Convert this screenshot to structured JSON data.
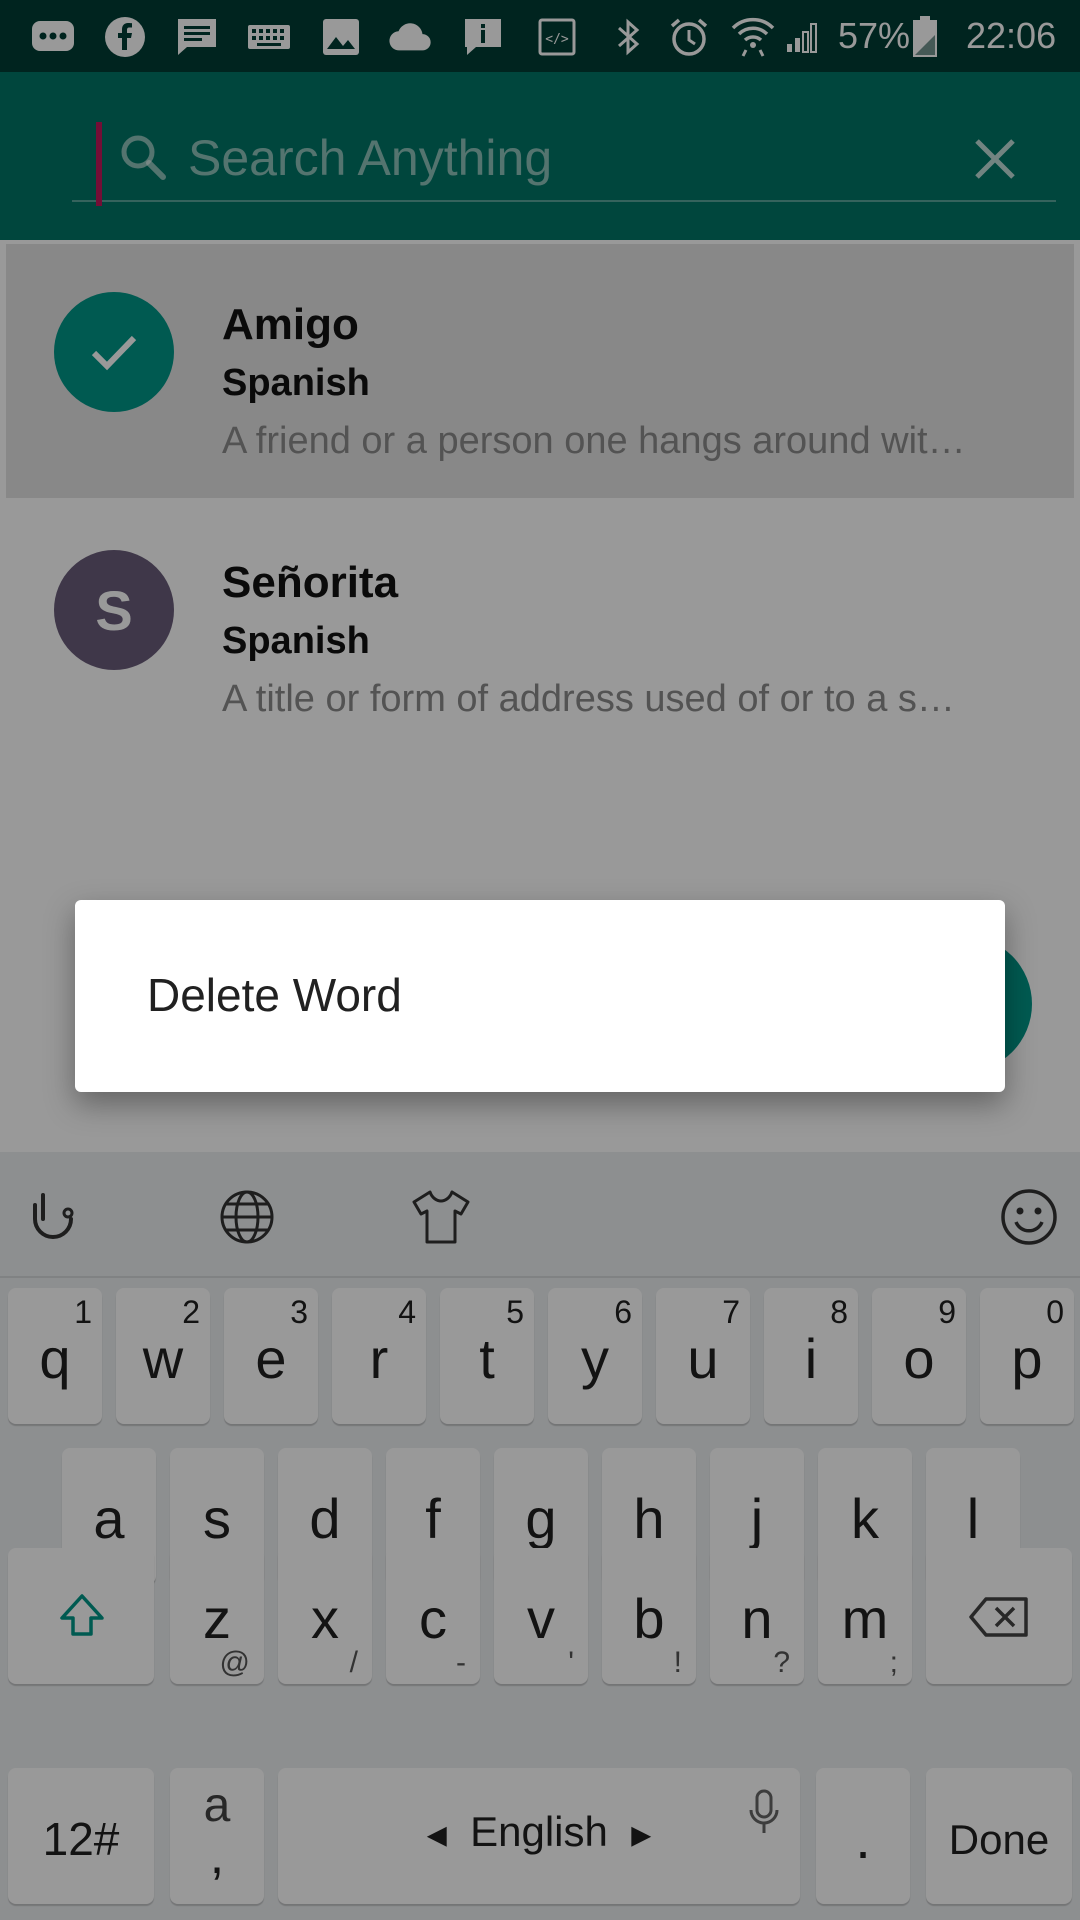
{
  "status_bar": {
    "battery": "57%",
    "time": "22:06",
    "icons": [
      "messages-icon",
      "facebook-icon",
      "chat-icon",
      "keyboard-icon",
      "image-icon",
      "cloud-icon",
      "info-icon",
      "code-icon",
      "bluetooth-icon",
      "alarm-icon",
      "wifi-icon",
      "signal-icon",
      "battery-icon"
    ]
  },
  "search": {
    "placeholder": "Search Anything",
    "value": ""
  },
  "colors": {
    "primary": "#009688",
    "primary_dark": "#00574b",
    "accent": "#c2185b",
    "avatar_s": "#6a5d7a"
  },
  "words": [
    {
      "avatar": "",
      "word": "Amigo",
      "language": "Spanish",
      "definition": "A friend or a person one hangs around wit…",
      "selected": true
    },
    {
      "avatar": "S",
      "word": "Señorita",
      "language": "Spanish",
      "definition": "A title or form of address used of or to a s…",
      "selected": false
    }
  ],
  "dialog": {
    "items": [
      "Delete Word"
    ]
  },
  "keyboard": {
    "row1": [
      [
        "q",
        "1"
      ],
      [
        "w",
        "2"
      ],
      [
        "e",
        "3"
      ],
      [
        "r",
        "4"
      ],
      [
        "t",
        "5"
      ],
      [
        "y",
        "6"
      ],
      [
        "u",
        "7"
      ],
      [
        "i",
        "8"
      ],
      [
        "o",
        "9"
      ],
      [
        "p",
        "0"
      ]
    ],
    "row2": [
      [
        "a",
        "\\"
      ],
      [
        "s",
        "_"
      ],
      [
        "d",
        "("
      ],
      [
        "f",
        ":"
      ],
      [
        "g",
        ")"
      ],
      [
        "h",
        "&"
      ],
      [
        "j",
        "#"
      ],
      [
        "k",
        "*"
      ],
      [
        "l",
        "\""
      ]
    ],
    "row3": [
      [
        "z",
        "@"
      ],
      [
        "x",
        "/"
      ],
      [
        "c",
        "-"
      ],
      [
        "v",
        "'"
      ],
      [
        "b",
        "!"
      ],
      [
        "n",
        "?"
      ],
      [
        "m",
        ";"
      ]
    ],
    "numbers_key": "12#",
    "comma_key_top": "a",
    "comma_key_bottom": ",",
    "space_label": "English",
    "period_key": ".",
    "done_key": "Done"
  }
}
